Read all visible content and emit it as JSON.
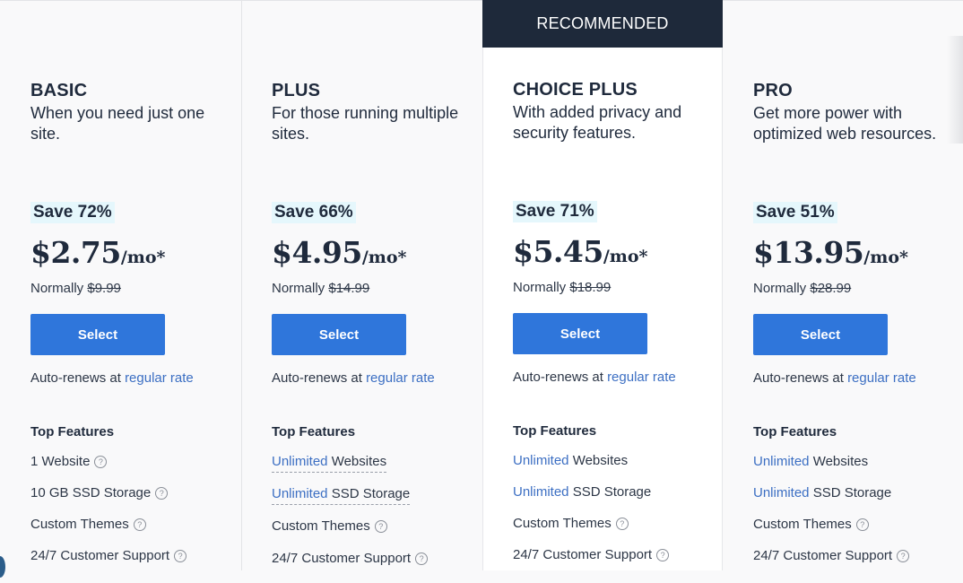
{
  "recommended_label": "RECOMMENDED",
  "plans": [
    {
      "name": "BASIC",
      "description": "When you need just one site.",
      "save": "Save 72%",
      "price": "$2.75",
      "per": "/mo*",
      "normally_label": "Normally",
      "normally_price": "$9.99",
      "select_label": "Select",
      "renew_prefix": "Auto-renews at",
      "renew_link": "regular rate",
      "features_title": "Top Features",
      "features": [
        {
          "highlight": "",
          "text": "1 Website",
          "help": true
        },
        {
          "highlight": "",
          "text": "10 GB SSD Storage",
          "help": true
        },
        {
          "highlight": "",
          "text": "Custom Themes",
          "help": true
        },
        {
          "highlight": "",
          "text": "24/7 Customer Support",
          "help": true
        }
      ]
    },
    {
      "name": "PLUS",
      "description": "For those running multiple sites.",
      "save": "Save 66%",
      "price": "$4.95",
      "per": "/mo*",
      "normally_label": "Normally",
      "normally_price": "$14.99",
      "select_label": "Select",
      "renew_prefix": "Auto-renews at",
      "renew_link": "regular rate",
      "features_title": "Top Features",
      "features": [
        {
          "highlight": "Unlimited",
          "text": " Websites",
          "help": false
        },
        {
          "highlight": "Unlimited",
          "text": " SSD Storage",
          "help": false
        },
        {
          "highlight": "",
          "text": "Custom Themes",
          "help": true
        },
        {
          "highlight": "",
          "text": "24/7 Customer Support",
          "help": true
        }
      ]
    },
    {
      "name": "CHOICE PLUS",
      "description": "With added privacy and security features.",
      "save": "Save 71%",
      "price": "$5.45",
      "per": "/mo*",
      "normally_label": "Normally",
      "normally_price": "$18.99",
      "select_label": "Select",
      "renew_prefix": "Auto-renews at",
      "renew_link": "regular rate",
      "features_title": "Top Features",
      "features": [
        {
          "highlight": "Unlimited",
          "text": " Websites",
          "help": false
        },
        {
          "highlight": "Unlimited",
          "text": " SSD Storage",
          "help": false
        },
        {
          "highlight": "",
          "text": "Custom Themes",
          "help": true
        },
        {
          "highlight": "",
          "text": "24/7 Customer Support",
          "help": true
        }
      ]
    },
    {
      "name": "PRO",
      "description": "Get more power with optimized web resources.",
      "save": "Save 51%",
      "price": "$13.95",
      "per": "/mo*",
      "normally_label": "Normally",
      "normally_price": "$28.99",
      "select_label": "Select",
      "renew_prefix": "Auto-renews at",
      "renew_link": "regular rate",
      "features_title": "Top Features",
      "features": [
        {
          "highlight": "Unlimited",
          "text": " Websites",
          "help": false
        },
        {
          "highlight": "Unlimited",
          "text": " SSD Storage",
          "help": false
        },
        {
          "highlight": "",
          "text": "Custom Themes",
          "help": true
        },
        {
          "highlight": "",
          "text": "24/7 Customer Support",
          "help": true
        }
      ]
    }
  ],
  "help_glyph": "?",
  "colors": {
    "accent_button": "#2f76db",
    "banner": "#1e293a",
    "save_badge_bg": "#e5f7fc",
    "link": "#3c6fc3",
    "text": "#1f2a3c"
  }
}
